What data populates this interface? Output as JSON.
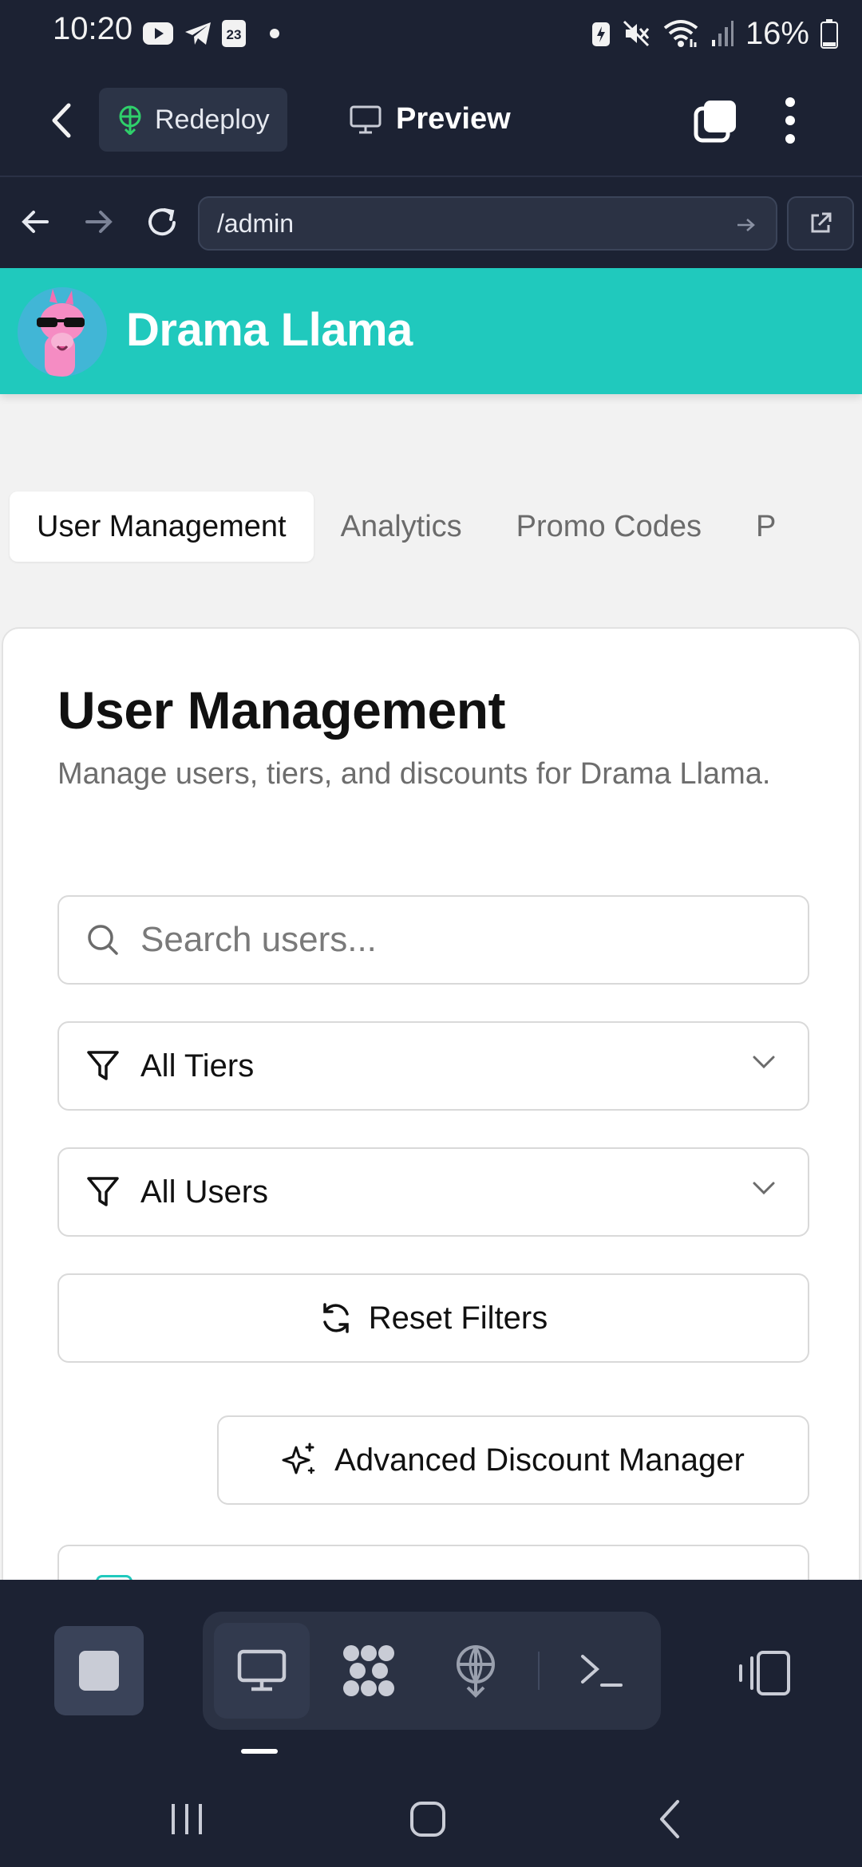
{
  "status_bar": {
    "time": "10:20",
    "calendar_day": "23",
    "battery_percent": "16%",
    "icons": [
      "youtube-icon",
      "telegram-icon",
      "calendar-icon",
      "notification-dot-icon",
      "battery-saver-icon",
      "mute-icon",
      "wifi-icon",
      "signal-icon",
      "battery-icon"
    ]
  },
  "replit_bar": {
    "redeploy_label": "Redeploy",
    "preview_label": "Preview",
    "accent": "#2fd06b"
  },
  "address_bar": {
    "url": "/admin"
  },
  "site": {
    "brand_name": "Drama Llama",
    "brand_color": "#20c9bd",
    "tabs": [
      {
        "label": "User Management",
        "active": true
      },
      {
        "label": "Analytics",
        "active": false
      },
      {
        "label": "Promo Codes",
        "active": false
      },
      {
        "label": "P",
        "active": false
      }
    ],
    "card": {
      "title": "User Management",
      "subtitle": "Manage users, tiers, and discounts for Drama Llama.",
      "search_placeholder": "Search users...",
      "tier_filter": "All Tiers",
      "user_filter": "All Users",
      "reset_label": "Reset Filters",
      "advanced_label": "Advanced Discount Manager"
    }
  },
  "bottom_toolbar": {
    "tools": [
      "monitor-icon",
      "workspace-icon",
      "deploy-icon",
      "terminal-icon"
    ]
  }
}
